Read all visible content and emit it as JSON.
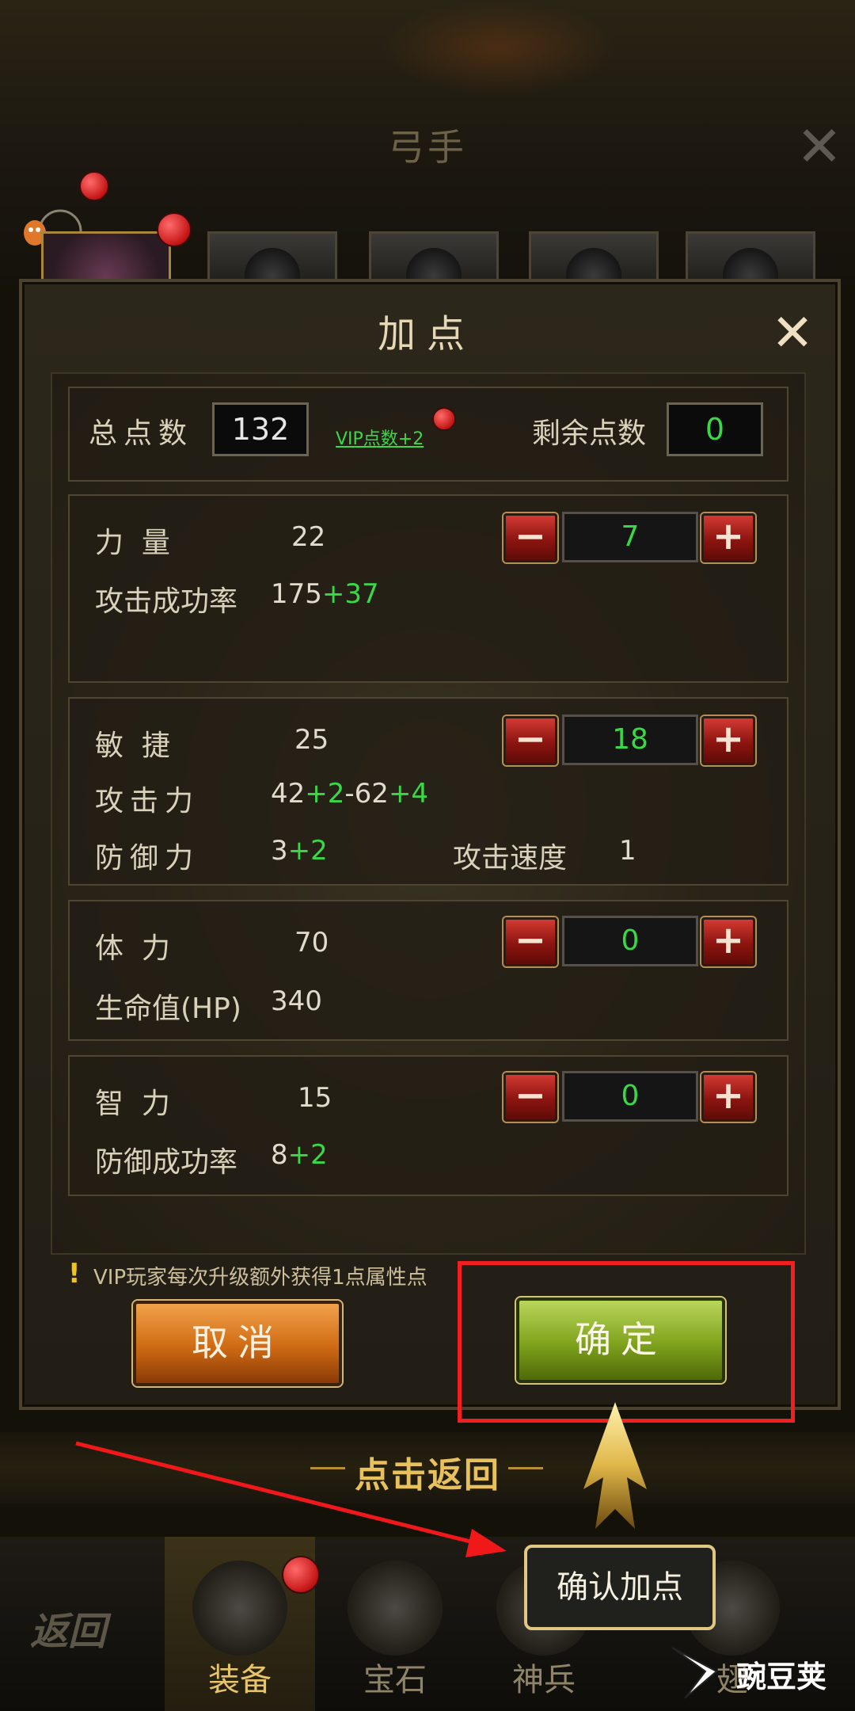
{
  "header": {
    "class_title": "弓手"
  },
  "dialog": {
    "title": "加点",
    "totals": {
      "total_label": "总点数",
      "total_value": "132",
      "vip_link": "VIP点数+2",
      "remaining_label": "剩余点数",
      "remaining_value": "0"
    },
    "attributes": [
      {
        "name": "力  量",
        "base": "22",
        "alloc": "7",
        "stats": [
          {
            "label": "攻击成功率",
            "parts": [
              "175",
              "+37"
            ]
          }
        ]
      },
      {
        "name": "敏  捷",
        "base": "25",
        "alloc": "18",
        "stats": [
          {
            "label": "攻击力",
            "parts": [
              "42",
              "+2",
              "-62",
              "+4"
            ]
          },
          {
            "label": "防御力",
            "parts": [
              "3",
              "+2"
            ]
          },
          {
            "label": "攻击速度",
            "parts": [
              "1"
            ]
          }
        ]
      },
      {
        "name": "体  力",
        "base": "70",
        "alloc": "0",
        "stats": [
          {
            "label": "生命值(HP)",
            "parts": [
              "340"
            ]
          }
        ]
      },
      {
        "name": "智  力",
        "base": "15",
        "alloc": "0",
        "stats": [
          {
            "label": "防御成功率",
            "parts": [
              "8",
              "+2"
            ]
          }
        ]
      }
    ],
    "minus": "−",
    "plus": "+",
    "tip": "VIP玩家每次升级额外获得1点属性点",
    "cancel_label": "取消",
    "confirm_label": "确定"
  },
  "return_bar": {
    "label": "点击返回"
  },
  "bottom_nav": {
    "back": "返回",
    "items": [
      "装备",
      "宝石",
      "神兵",
      "翅"
    ]
  },
  "tooltip": "确认加点",
  "watermark": "豌豆荚",
  "colors": {
    "accent_green": "#3ad846",
    "highlight_red": "#f02020",
    "gold": "#e8c15c"
  }
}
